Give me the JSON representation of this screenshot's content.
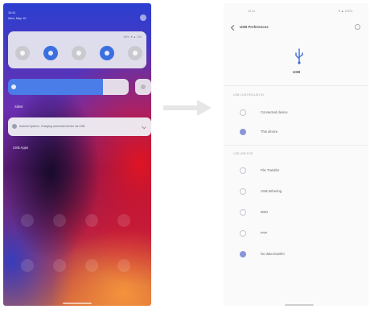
{
  "left_phone": {
    "status": {
      "time": "10:41",
      "date": "Wed, May 10",
      "battery": "85% ▼▲ 100"
    },
    "tiles": [
      {
        "name": "wifi",
        "on": false
      },
      {
        "name": "mobile-data",
        "on": true
      },
      {
        "name": "bluetooth",
        "on": false
      },
      {
        "name": "airplane",
        "on": true
      },
      {
        "name": "flashlight",
        "on": false
      }
    ],
    "section_title": "Silent",
    "notification_text": "Android System • Charging connected device via USB",
    "footer_label": "USB Apps"
  },
  "right_phone": {
    "status": {
      "time": "10:41",
      "icons": "▼▲ 100%"
    },
    "title": "USB Preferences",
    "usb_label": "USB",
    "section_controlled": "USB CONTROLLED BY",
    "controlled_options": [
      {
        "label": "Connected device",
        "checked": false
      },
      {
        "label": "This device",
        "checked": true
      }
    ],
    "section_use": "USE USB FOR",
    "use_options": [
      {
        "label": "File Transfer",
        "checked": false
      },
      {
        "label": "USB tethering",
        "checked": false
      },
      {
        "label": "MIDI",
        "checked": false
      },
      {
        "label": "PTP",
        "checked": false
      },
      {
        "label": "No data transfer",
        "checked": true
      }
    ]
  },
  "colors": {
    "accent": "#4a7de8",
    "usb_icon": "#3f6ad8",
    "radio_checked": "#8a96d8"
  }
}
